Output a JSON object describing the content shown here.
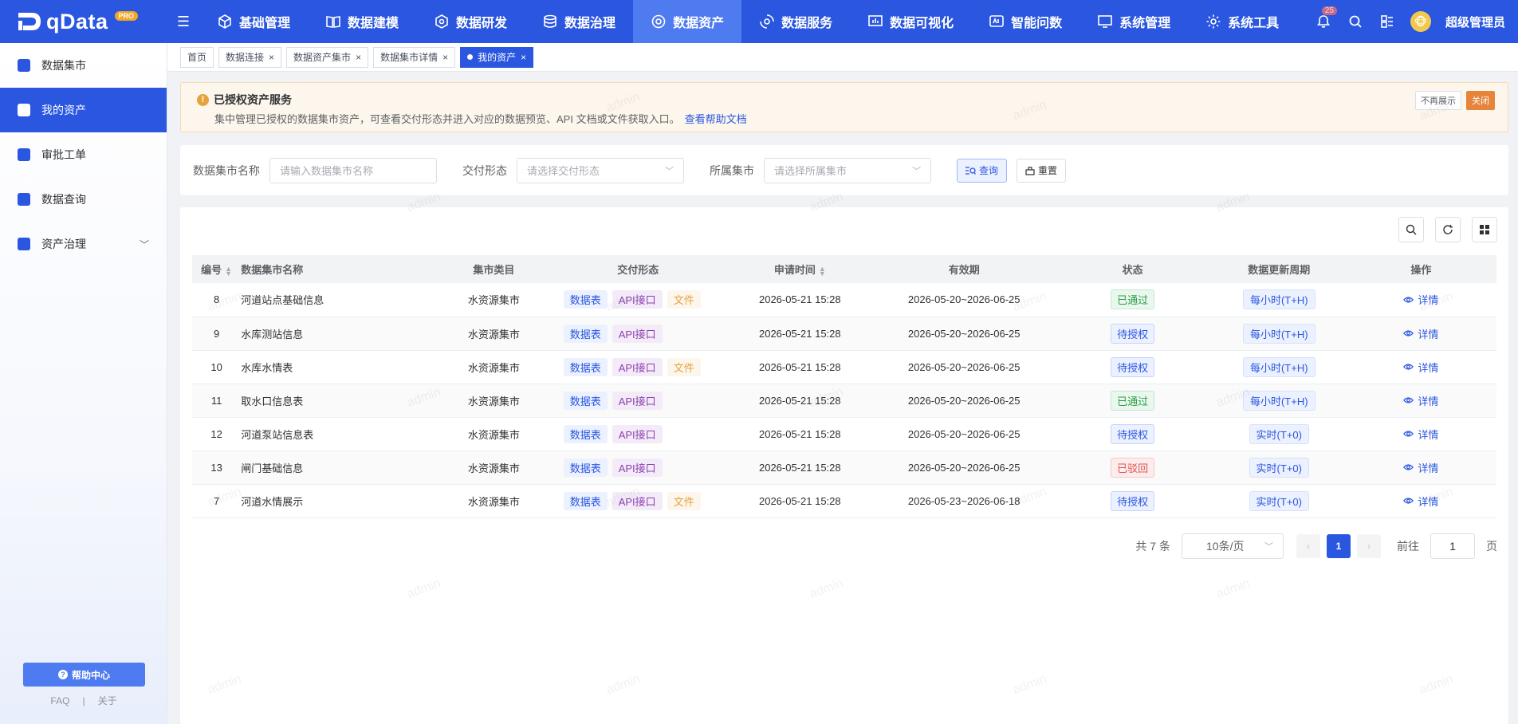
{
  "app": {
    "logo_text": "qData",
    "logo_badge": "PRO"
  },
  "nav": [
    {
      "label": "基础管理",
      "icon": "cube-icon"
    },
    {
      "label": "数据建模",
      "icon": "book-icon"
    },
    {
      "label": "数据研发",
      "icon": "code-icon"
    },
    {
      "label": "数据治理",
      "icon": "database-icon"
    },
    {
      "label": "数据资产",
      "icon": "asset-icon",
      "active": true
    },
    {
      "label": "数据服务",
      "icon": "service-icon"
    },
    {
      "label": "数据可视化",
      "icon": "chart-icon"
    },
    {
      "label": "智能问数",
      "icon": "ai-icon"
    },
    {
      "label": "系统管理",
      "icon": "monitor-icon"
    },
    {
      "label": "系统工具",
      "icon": "gear-icon"
    }
  ],
  "topright": {
    "bell_count": "25",
    "username": "超级管理员"
  },
  "sidebar": {
    "items": [
      {
        "label": "数据集市"
      },
      {
        "label": "我的资产",
        "active": true
      },
      {
        "label": "审批工单"
      },
      {
        "label": "数据查询"
      },
      {
        "label": "资产治理",
        "has_arrow": true
      }
    ],
    "help_label": "帮助中心",
    "faq": "FAQ",
    "sep": "|",
    "about": "关于"
  },
  "tabs": [
    {
      "label": "首页",
      "closable": false
    },
    {
      "label": "数据连接",
      "closable": true
    },
    {
      "label": "数据资产集市",
      "closable": true
    },
    {
      "label": "数据集市详情",
      "closable": true
    },
    {
      "label": "我的资产",
      "closable": true,
      "active": true
    }
  ],
  "notice": {
    "title": "已授权资产服务",
    "desc": "集中管理已授权的数据集市资产，可查看交付形态并进入对应的数据预览、API 文档或文件获取入口。",
    "link": "查看帮助文档",
    "hide_label": "不再展示",
    "close_label": "关闭"
  },
  "filter": {
    "name_label": "数据集市名称",
    "name_placeholder": "请输入数据集市名称",
    "form_label": "交付形态",
    "form_placeholder": "请选择交付形态",
    "market_label": "所属集市",
    "market_placeholder": "请选择所属集市",
    "query_label": "查询",
    "reset_label": "重置"
  },
  "table": {
    "headers": [
      "编号",
      "数据集市名称",
      "集市类目",
      "交付形态",
      "申请时间",
      "有效期",
      "状态",
      "数据更新周期",
      "操作"
    ],
    "detail_label": "详情",
    "rows": [
      {
        "id": "8",
        "name": "河道站点基础信息",
        "cat": "水资源集市",
        "forms": [
          "数据表",
          "API接口",
          "文件"
        ],
        "time": "2026-05-21 15:28",
        "valid": "2026-05-20~2026-06-25",
        "status": "已通过",
        "status_type": "pass",
        "cycle": "每小时(T+H)"
      },
      {
        "id": "9",
        "name": "水库测站信息",
        "cat": "水资源集市",
        "forms": [
          "数据表",
          "API接口"
        ],
        "time": "2026-05-21 15:28",
        "valid": "2026-05-20~2026-06-25",
        "status": "待授权",
        "status_type": "wait",
        "cycle": "每小时(T+H)"
      },
      {
        "id": "10",
        "name": "水库水情表",
        "cat": "水资源集市",
        "forms": [
          "数据表",
          "API接口",
          "文件"
        ],
        "time": "2026-05-21 15:28",
        "valid": "2026-05-20~2026-06-25",
        "status": "待授权",
        "status_type": "wait",
        "cycle": "每小时(T+H)"
      },
      {
        "id": "11",
        "name": "取水口信息表",
        "cat": "水资源集市",
        "forms": [
          "数据表",
          "API接口"
        ],
        "time": "2026-05-21 15:28",
        "valid": "2026-05-20~2026-06-25",
        "status": "已通过",
        "status_type": "pass",
        "cycle": "每小时(T+H)"
      },
      {
        "id": "12",
        "name": "河道泵站信息表",
        "cat": "水资源集市",
        "forms": [
          "数据表",
          "API接口"
        ],
        "time": "2026-05-21 15:28",
        "valid": "2026-05-20~2026-06-25",
        "status": "待授权",
        "status_type": "wait",
        "cycle": "实时(T+0)"
      },
      {
        "id": "13",
        "name": "闸门基础信息",
        "cat": "水资源集市",
        "forms": [
          "数据表",
          "API接口"
        ],
        "time": "2026-05-21 15:28",
        "valid": "2026-05-20~2026-06-25",
        "status": "已驳回",
        "status_type": "reject",
        "cycle": "实时(T+0)"
      },
      {
        "id": "7",
        "name": "河道水情展示",
        "cat": "水资源集市",
        "forms": [
          "数据表",
          "API接口",
          "文件"
        ],
        "time": "2026-05-21 15:28",
        "valid": "2026-05-23~2026-06-18",
        "status": "待授权",
        "status_type": "wait",
        "cycle": "实时(T+0)"
      }
    ]
  },
  "pagination": {
    "total_label": "共 7 条",
    "page_size": "10条/页",
    "current": "1",
    "goto_label": "前往",
    "goto_value": "1",
    "page_unit": "页"
  },
  "watermark": "admin",
  "colors": {
    "primary": "#2a56e0",
    "warning": "#e6a23c",
    "success": "#2a9d44",
    "danger": "#e05252"
  }
}
